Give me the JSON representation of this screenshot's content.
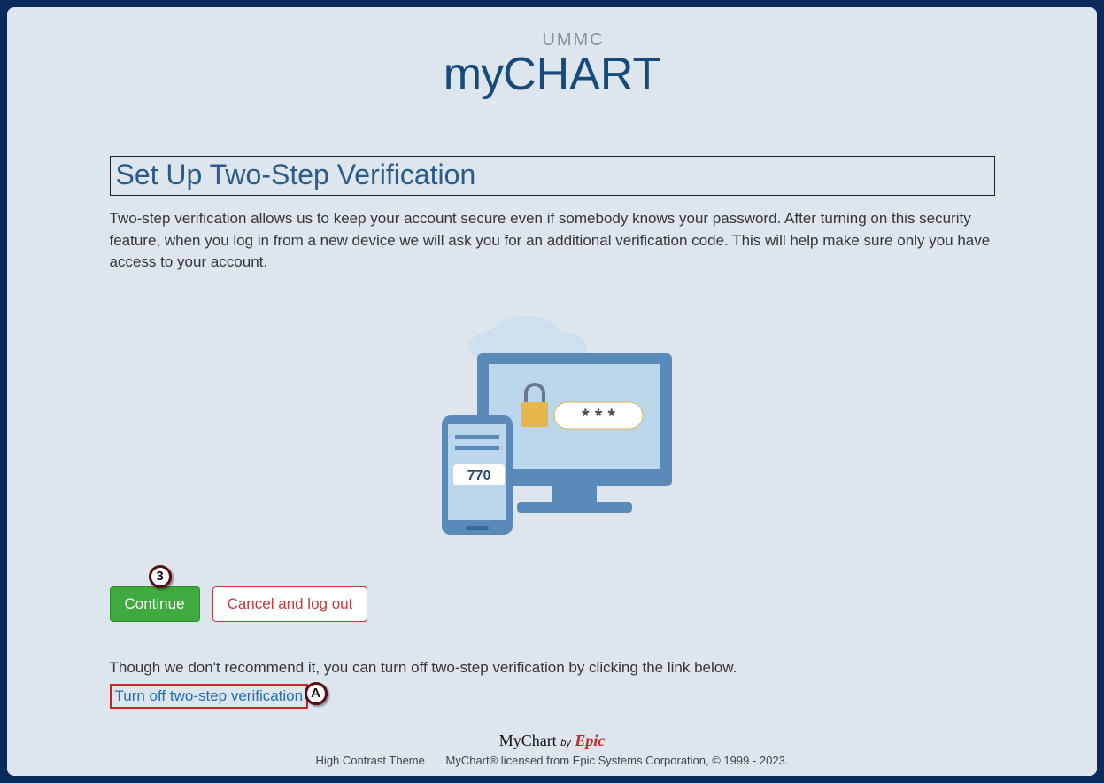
{
  "brand": {
    "org": "UMMC",
    "logo_my": "my",
    "logo_chart": "CHART"
  },
  "page": {
    "heading": "Set Up Two-Step Verification",
    "description": "Two-step verification allows us to keep your account secure even if somebody knows your password. After turning on this security feature, when you log in from a new device we will ask you for an additional verification code. This will help make sure only you have access to your account.",
    "illustration_code": "770",
    "illustration_mask": "* * *"
  },
  "buttons": {
    "continue": "Continue",
    "cancel": "Cancel and log out"
  },
  "opt_out": {
    "note": "Though we don't recommend it, you can turn off two-step verification by clicking the link below.",
    "link": "Turn off two-step verification"
  },
  "annotations": {
    "step3": "3",
    "stepA": "A"
  },
  "footer": {
    "brand_mychart": "MyChart",
    "brand_by": "by",
    "brand_epic": "Epic",
    "theme": "High Contrast Theme",
    "license": "MyChart® licensed from Epic Systems Corporation, © 1999 - 2023."
  }
}
